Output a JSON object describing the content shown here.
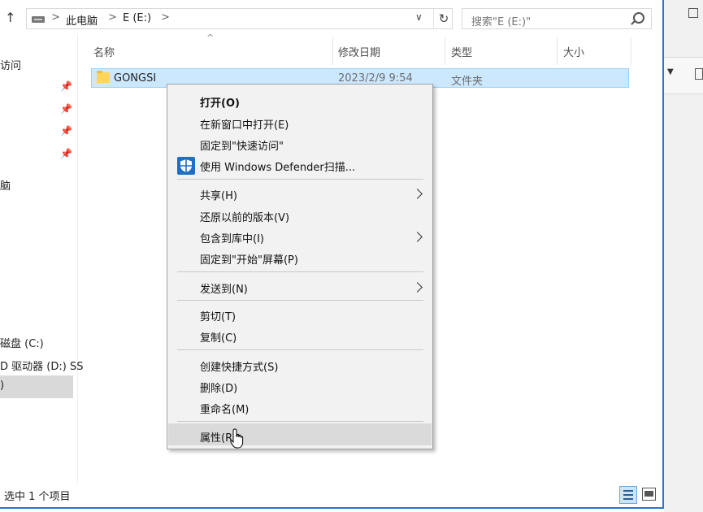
{
  "address": {
    "crumbs": [
      "此电脑",
      "E (E:)"
    ],
    "separators": [
      ">",
      ">",
      ">"
    ]
  },
  "search": {
    "placeholder": "搜索\"E (E:)\""
  },
  "nav_pane": {
    "items": [
      {
        "label": "访问"
      },
      {
        "label": "脑"
      },
      {
        "label": "磁盘 (C:)"
      },
      {
        "label": "D 驱动器 (D:) SS"
      },
      {
        "label": ")"
      }
    ]
  },
  "columns": [
    "名称",
    "修改日期",
    "类型",
    "大小"
  ],
  "file": {
    "name": "GONGSI",
    "modified": "2023/2/9 9:54",
    "type": "文件夹"
  },
  "context_menu": {
    "items": [
      "打开(O)",
      "在新窗口中打开(E)",
      "固定到\"快速访问\"",
      "使用 Windows Defender扫描...",
      "共享(H)",
      "还原以前的版本(V)",
      "包含到库中(I)",
      "固定到\"开始\"屏幕(P)",
      "发送到(N)",
      "剪切(T)",
      "复制(C)",
      "创建快捷方式(S)",
      "删除(D)",
      "重命名(M)",
      "属性(R)"
    ],
    "highlighted": "属性(R)"
  },
  "status": {
    "selection": "选中 1 个项目"
  },
  "icons": {
    "up": "up-arrow-icon",
    "drive": "drive-icon",
    "refresh": "refresh-icon",
    "search": "search-icon",
    "pin": "pin-icon",
    "folder": "folder-icon",
    "shield": "defender-shield-icon",
    "cursor": "mouse-cursor-icon"
  },
  "colors": {
    "selection": "#cce8ff",
    "window_border": "#2b76c8",
    "menu_bg": "#f2f2f2",
    "shield": "#1f6fc5"
  }
}
